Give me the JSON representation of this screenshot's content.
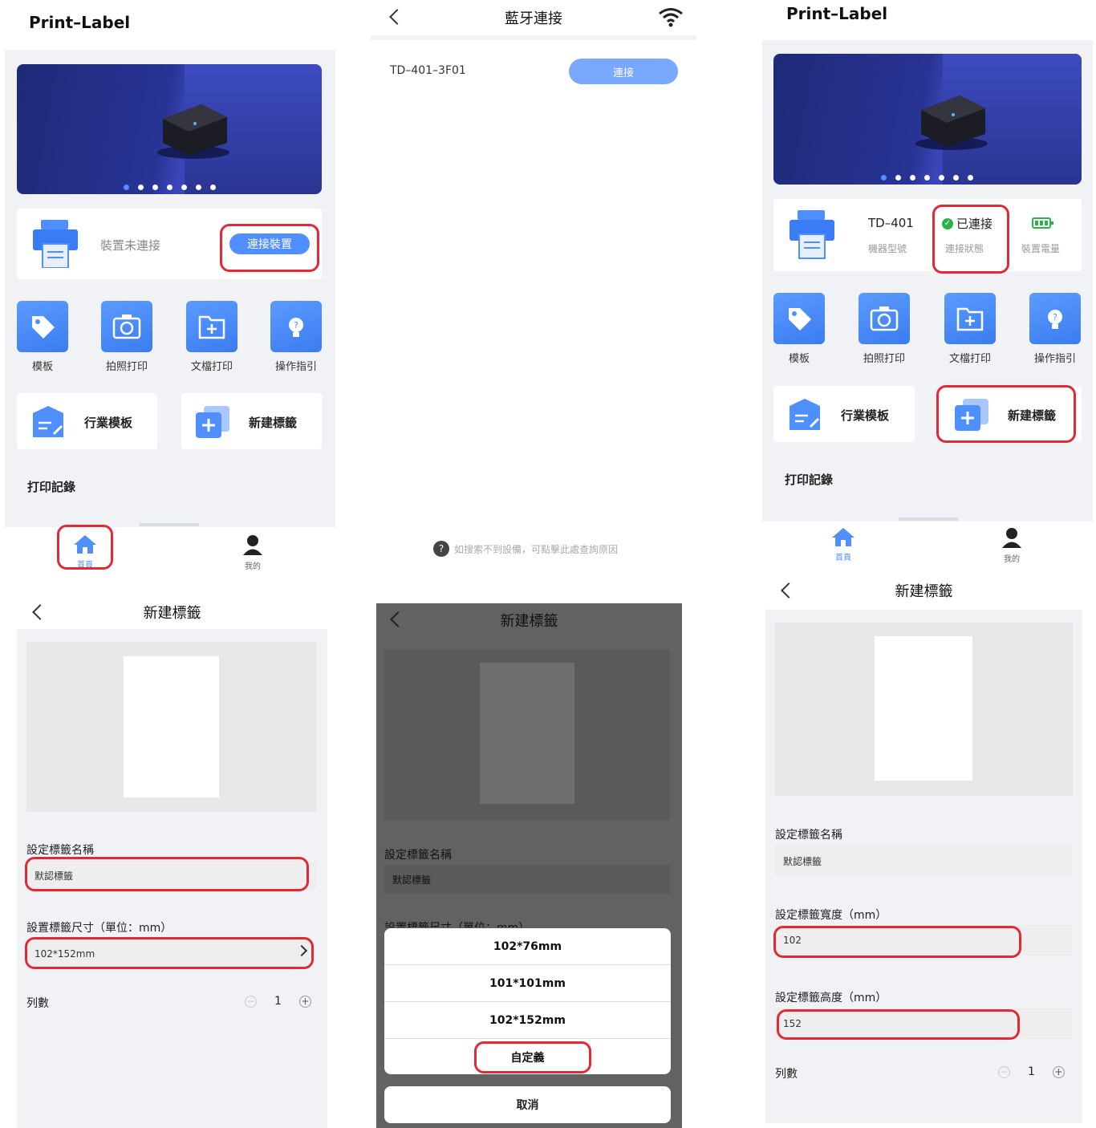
{
  "home1": {
    "app_title": "Print–Label",
    "device_status": "裝置未連接",
    "connect_button": "連接裝置",
    "apps": [
      "模板",
      "拍照打印",
      "文檔打印",
      "操作指引"
    ],
    "quick": [
      "行業模板",
      "新建標籤"
    ],
    "records_title": "打印記錄",
    "tabbar": [
      "首頁",
      "我的"
    ]
  },
  "bt": {
    "title": "藍牙連接",
    "device_name": "TD–401–3F01",
    "connect_button": "連接",
    "help": "如搜索不到設備，可點擊此處查詢原因"
  },
  "home2": {
    "app_title": "Print–Label",
    "model": "TD–401",
    "model_label": "機器型號",
    "status": "已連接",
    "status_label": "連接狀態",
    "battery_label": "裝置電量",
    "apps": [
      "模板",
      "拍照打印",
      "文檔打印",
      "操作指引"
    ],
    "quick": [
      "行業模板",
      "新建標籤"
    ],
    "records_title": "打印記錄",
    "tabbar": [
      "首頁",
      "我的"
    ]
  },
  "new1": {
    "title": "新建標籤",
    "name_label": "設定標籤名稱",
    "name_value": "默認標籤",
    "size_label": "設置標籤尺寸（單位：mm）",
    "size_value": "102*152mm",
    "columns_label": "列數",
    "columns_value": "1"
  },
  "new2": {
    "title": "新建標籤",
    "name_label": "設定標籤名稱",
    "name_value": "默認標籤",
    "size_label_partial": "設置標籤尺寸（單位：mm）",
    "options": [
      "102*76mm",
      "101*101mm",
      "102*152mm",
      "自定義"
    ],
    "cancel": "取消"
  },
  "new3": {
    "title": "新建標籤",
    "name_label": "設定標籤名稱",
    "name_value": "默認標籤",
    "width_label": "設定標籤寬度（mm）",
    "width_value": "102",
    "height_label": "設定標籤高度（mm）",
    "height_value": "152",
    "columns_label": "列數",
    "columns_value": "1"
  },
  "colors": {
    "accent": "#4f8fff",
    "highlight": "#e02a35",
    "grey": "#f1f2f6"
  }
}
